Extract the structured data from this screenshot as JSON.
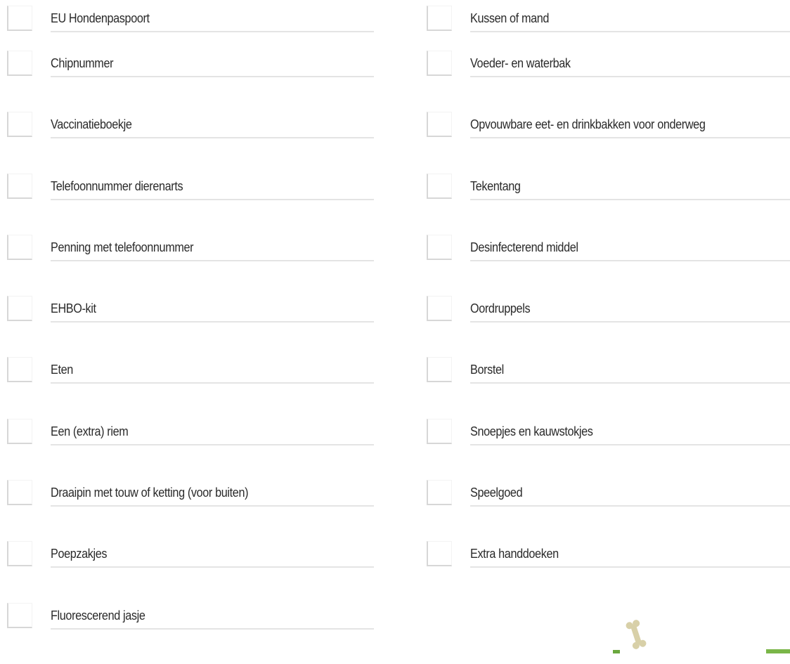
{
  "checklist": {
    "left": [
      {
        "label": "EU Hondenpaspoort",
        "checked": false
      },
      {
        "label": "Chipnummer",
        "checked": false
      },
      {
        "label": "Vaccinatieboekje",
        "checked": false
      },
      {
        "label": "Telefoonnummer dierenarts",
        "checked": false
      },
      {
        "label": "Penning met telefoonnummer",
        "checked": false
      },
      {
        "label": "EHBO-kit",
        "checked": false
      },
      {
        "label": "Eten",
        "checked": false
      },
      {
        "label": "Een (extra) riem",
        "checked": false
      },
      {
        "label": "Draaipin met touw of ketting (voor buiten)",
        "checked": false
      },
      {
        "label": "Poepzakjes",
        "checked": false
      },
      {
        "label": "Fluorescerend jasje",
        "checked": false
      }
    ],
    "right": [
      {
        "label": "Kussen of mand",
        "checked": false
      },
      {
        "label": "Voeder- en waterbak",
        "checked": false
      },
      {
        "label": "Opvouwbare eet- en drinkbakken voor onderweg",
        "checked": false
      },
      {
        "label": "Tekentang",
        "checked": false
      },
      {
        "label": "Desinfecterend middel",
        "checked": false
      },
      {
        "label": "Oordruppels",
        "checked": false
      },
      {
        "label": "Borstel",
        "checked": false
      },
      {
        "label": "Snoepjes en kauwstokjes",
        "checked": false
      },
      {
        "label": "Speelgoed",
        "checked": false
      },
      {
        "label": "Extra handdoeken",
        "checked": false
      }
    ]
  },
  "decor": {
    "bone_icon": "bone-icon",
    "bone_color": "#d8d0a8",
    "accent_green": "#7ab648"
  }
}
